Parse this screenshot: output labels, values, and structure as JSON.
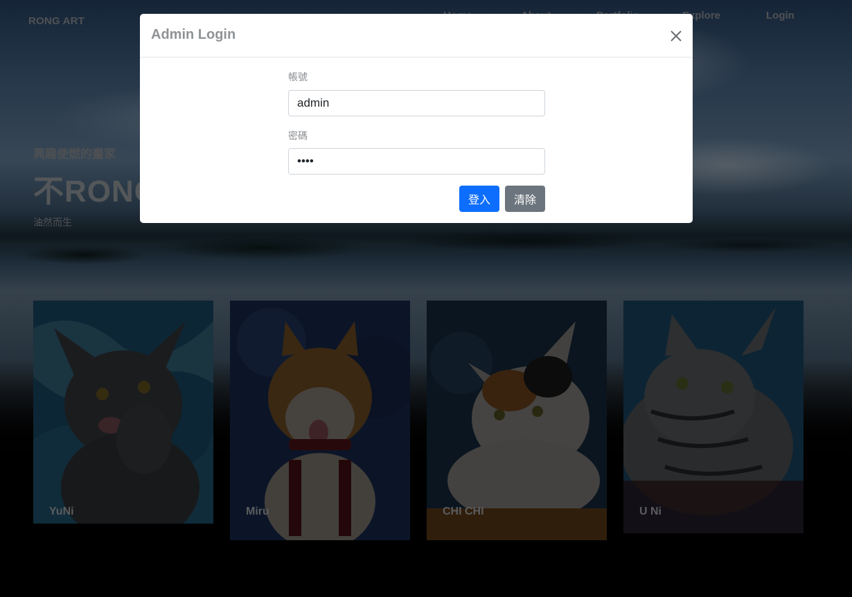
{
  "nav": {
    "brand": "RONG ART",
    "items": [
      "Home",
      "About",
      "Portfolio",
      "Explore",
      "Login"
    ]
  },
  "hero": {
    "subtitle": "興趣使燃的畫家",
    "title": "不RONG",
    "tagline": "油然而生"
  },
  "cards": [
    {
      "label": "YuNi",
      "icon": "gray-cat-painting"
    },
    {
      "label": "Miru",
      "icon": "shiba-dog-painting"
    },
    {
      "label": "CHI CHI",
      "icon": "calico-cat-painting"
    },
    {
      "label": "U Ni",
      "icon": "tabby-cat-painting"
    }
  ],
  "modal": {
    "title": "Admin Login",
    "username_label": "帳號",
    "username_value": "admin",
    "password_label": "密碼",
    "password_value": "1234",
    "login_button": "登入",
    "clear_button": "清除"
  },
  "colors": {
    "primary": "#0d6efd",
    "secondary": "#6c757d",
    "overlay": "rgba(0,0,0,0.5)"
  }
}
